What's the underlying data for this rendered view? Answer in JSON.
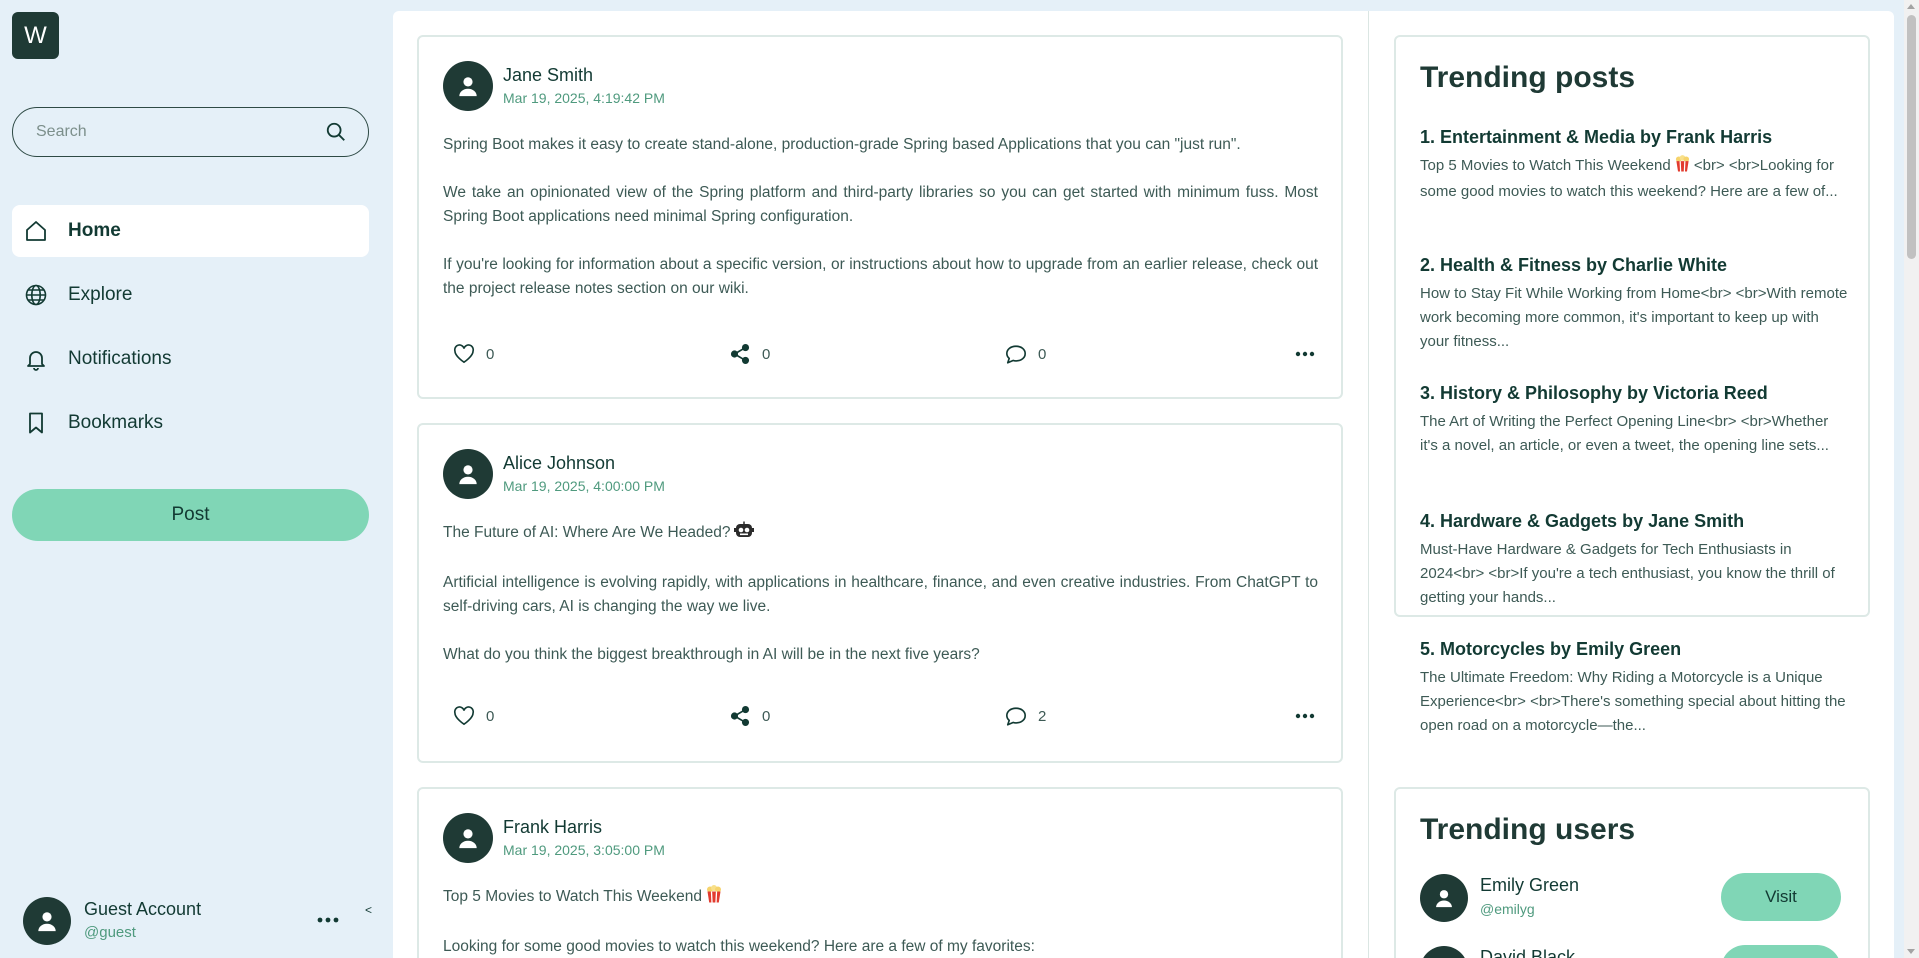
{
  "app": {
    "logo_letter": "W"
  },
  "search": {
    "placeholder": "Search"
  },
  "nav": {
    "items": [
      {
        "label": "Home",
        "icon": "home-icon",
        "active": true
      },
      {
        "label": "Explore",
        "icon": "globe-icon",
        "active": false
      },
      {
        "label": "Notifications",
        "icon": "bell-icon",
        "active": false
      },
      {
        "label": "Bookmarks",
        "icon": "bookmark-icon",
        "active": false
      }
    ],
    "post_label": "Post"
  },
  "account": {
    "name": "Guest Account",
    "handle": "@guest",
    "caret": "˂"
  },
  "posts": [
    {
      "author": "Jane Smith",
      "date": "Mar 19, 2025, 4:19:42 PM",
      "paragraphs": [
        "Spring Boot makes it easy to create stand-alone, production-grade Spring based Applications that you can \"just run\".",
        "We take an opinionated view of the Spring platform and third-party libraries so you can get started with minimum fuss. Most Spring Boot applications need minimal Spring configuration.",
        "If you're looking for information about a specific version, or instructions about how to upgrade from an earlier release, check out the project release notes section on our wiki."
      ],
      "likes": "0",
      "shares": "0",
      "comments": "0"
    },
    {
      "author": "Alice Johnson",
      "date": "Mar 19, 2025, 4:00:00 PM",
      "paragraphs": [
        "The Future of AI: Where Are We Headed?",
        "Artificial intelligence is evolving rapidly, with applications in healthcare, finance, and even creative industries. From ChatGPT to self-driving cars, AI is changing the way we live.",
        "What do you think the biggest breakthrough in AI will be in the next five years?"
      ],
      "title_emoji": "robot-emoji",
      "likes": "0",
      "shares": "0",
      "comments": "2"
    },
    {
      "author": "Frank Harris",
      "date": "Mar 19, 2025, 3:05:00 PM",
      "paragraphs": [
        "Top 5 Movies to Watch This Weekend",
        "Looking for some good movies to watch this weekend? Here are a few of my favorites:"
      ],
      "title_emoji": "popcorn-emoji"
    }
  ],
  "trending_posts": {
    "title": "Trending posts",
    "items": [
      {
        "title": "1. Entertainment & Media by Frank Harris",
        "excerpt_before_emoji": "Top 5 Movies to Watch This Weekend",
        "excerpt_after_emoji": " <br> <br>Looking for some good movies to watch this weekend? Here are a few of..."
      },
      {
        "title": "2. Health & Fitness by Charlie White",
        "excerpt": "How to Stay Fit While Working from Home<br> <br>With remote work becoming more common, it's important to keep up with your fitness..."
      },
      {
        "title": "3. History & Philosophy by Victoria Reed",
        "excerpt": "The Art of Writing the Perfect Opening Line<br> <br>Whether it's a novel, an article, or even a tweet, the opening line sets..."
      },
      {
        "title": "4. Hardware & Gadgets by Jane Smith",
        "excerpt": "Must-Have Hardware & Gadgets for Tech Enthusiasts in 2024<br> <br>If you're a tech enthusiast, you know the thrill of getting your hands..."
      },
      {
        "title": "5. Motorcycles by Emily Green",
        "excerpt": "The Ultimate Freedom: Why Riding a Motorcycle is a Unique Experience<br> <br>There's something special about hitting the open road on a motorcycle—the..."
      }
    ]
  },
  "trending_users": {
    "title": "Trending users",
    "visit_label": "Visit",
    "users": [
      {
        "name": "Emily Green",
        "handle": "@emilyg"
      },
      {
        "name": "David Black",
        "handle": ""
      }
    ]
  },
  "colors": {
    "background": "#e5f0f8",
    "accent": "#80d6b6",
    "dark": "#1f3a35",
    "muted_green": "#4f9a7e"
  }
}
